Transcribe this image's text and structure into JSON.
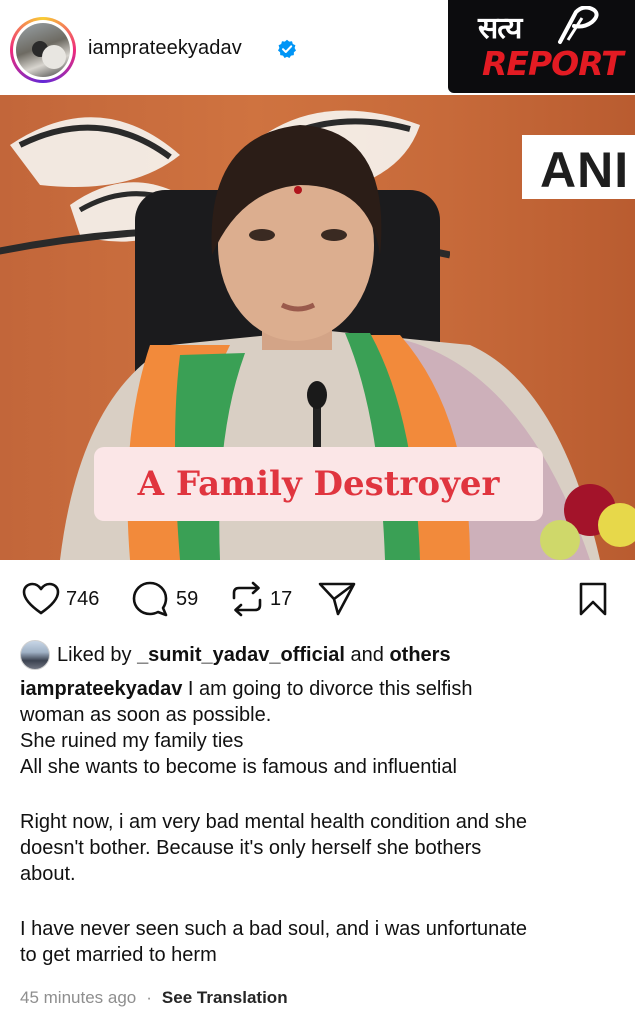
{
  "header": {
    "username": "iamprateekyadav",
    "verified": true
  },
  "logo": {
    "hindi": "सत्य",
    "report": "REPORT"
  },
  "post_image": {
    "corner_text": "ANI",
    "overlay_text": "A Family Destroyer"
  },
  "actions": {
    "likes": "746",
    "comments": "59",
    "reposts": "17",
    "icons": [
      "heart-icon",
      "comment-icon",
      "repost-icon",
      "share-icon",
      "bookmark-icon"
    ]
  },
  "liked_by": {
    "prefix": "Liked by",
    "user": "_sumit_yadav_official",
    "and": "and",
    "others": "others"
  },
  "caption": {
    "username": "iamprateekyadav",
    "line1": "I am going to divorce this selfish",
    "line2": "woman as soon as possible.",
    "line3": "She ruined my family ties",
    "line4": "All she wants to become is famous and influential",
    "para2_line1": "Right now, i am very bad mental health condition and she",
    "para2_line2": "doesn't bother. Because it's only herself she bothers",
    "para2_line3": "about.",
    "para3_line1": "I have never seen such a bad soul, and i was unfortunate",
    "para3_line2": "to get married to herm"
  },
  "meta": {
    "time": "45 minutes ago",
    "separator": "·",
    "translation": "See Translation"
  },
  "colors": {
    "verified": "#0095f6",
    "overlay_text": "#e0353f",
    "overlay_bg": "#fbe6e7",
    "logo_red": "#e31b23"
  }
}
